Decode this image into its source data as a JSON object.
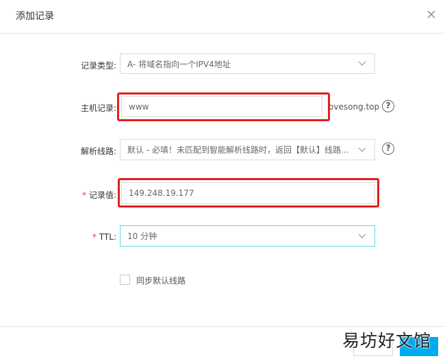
{
  "dialog": {
    "title": "添加记录"
  },
  "form": {
    "record_type": {
      "label": "记录类型:",
      "value": "A- 将域名指向一个IPV4地址"
    },
    "host": {
      "label": "主机记录:",
      "value": "www",
      "suffix": "ovesong.top"
    },
    "line": {
      "label": "解析线路:",
      "value": "默认 - 必填！未匹配到智能解析线路时，返回【默认】线路..."
    },
    "record_value": {
      "label": "记录值:",
      "required_mark": "*",
      "value": "149.248.19.177"
    },
    "ttl": {
      "label": "TTL:",
      "required_mark": "*",
      "value": "10 分钟"
    },
    "sync_default": {
      "label": "同步默认线路",
      "checked": false
    }
  },
  "watermark": {
    "text": "易坊好文馆"
  },
  "colors": {
    "highlight": "#e0201a",
    "focus_border": "#5fd6e6",
    "primary_button": "#00aaee",
    "required": "#e4393c"
  },
  "icons": [
    "close-icon",
    "chevron-down-icon",
    "help-icon",
    "checkbox-icon"
  ]
}
